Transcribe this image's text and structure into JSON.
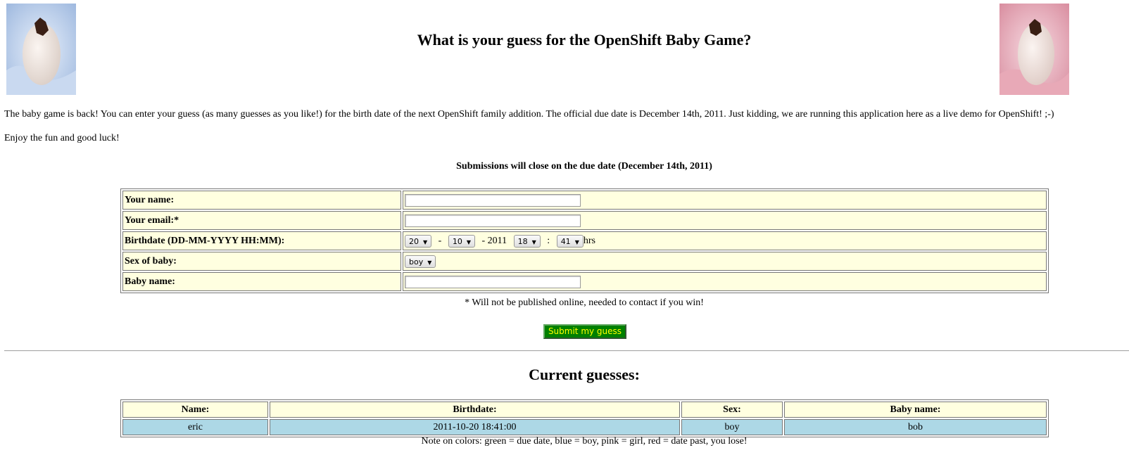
{
  "header": {
    "title": "What is your guess for the OpenShift Baby Game?"
  },
  "intro": {
    "paragraph": "The baby game is back! You can enter your guess (as many guesses as you like!) for the birth date of the next OpenShift family addition. The official due date is December 14th, 2011. Just kidding, we are running this application here as a live demo for OpenShift! ;-)",
    "enjoy": "Enjoy the fun and good luck!",
    "closing_note": "Submissions will close on the due date (December 14th, 2011)"
  },
  "form": {
    "name_label": "Your name:",
    "name_value": "",
    "email_label": "Your email:*",
    "email_value": "",
    "birthdate_label": "Birthdate (DD-MM-YYYY HH:MM):",
    "day": "20",
    "month": "10",
    "year_text": "- 2011",
    "hour": "18",
    "minute": "41",
    "dash": "-",
    "colon": ":",
    "hrs": "hrs",
    "sex_label": "Sex of baby:",
    "sex_value": "boy",
    "babyname_label": "Baby name:",
    "babyname_value": "",
    "footnote": "* Will not be published online, needed to contact if you win!",
    "submit_label": "Submit my guess"
  },
  "guesses": {
    "heading": "Current guesses:",
    "columns": [
      "Name:",
      "Birthdate:",
      "Sex:",
      "Baby name:"
    ],
    "rows": [
      {
        "name": "eric",
        "birthdate": "2011-10-20 18:41:00",
        "sex": "boy",
        "baby_name": "bob"
      }
    ],
    "colors_note": "Note on colors: green = due date, blue = boy, pink = girl, red = date past, you lose!"
  },
  "colors": {
    "cell_bg": "#ffffe0",
    "boy_row": "#add8e6",
    "submit_bg": "#008000",
    "submit_text": "#ffff00"
  },
  "icons": {
    "left_image": "egg-blue-image",
    "right_image": "egg-pink-image"
  }
}
